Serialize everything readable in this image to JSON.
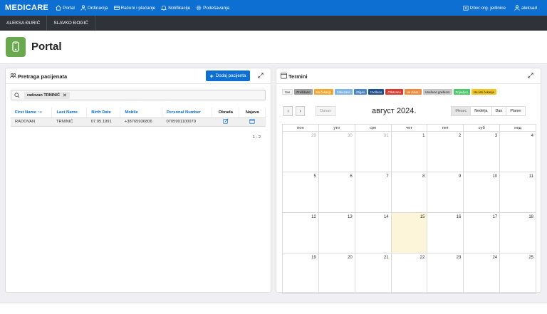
{
  "topbar": {
    "brand": "MEDICARE",
    "nav": [
      "Portal",
      "Ordinacija",
      "Računi i plaćanje",
      "Notifikacije",
      "Podešavanja"
    ],
    "org_unit": "Izbor org. jedinice",
    "user": "aleksad"
  },
  "user_tabs": [
    "ALEKSA ĐURIĆ",
    "SLAVKO ĐOGIĆ"
  ],
  "page_title": "Portal",
  "patients": {
    "title": "Pretraga pacijenata",
    "add_button": "Dodaj pacijenta",
    "search_chip": "radovan TRNINIĆ",
    "columns": [
      "First Name",
      "Last Name",
      "Birth Date",
      "Mobile",
      "Personal Number",
      "Obrada",
      "Najava"
    ],
    "rows": [
      [
        "RADOVAN",
        "TRNINIĆ",
        "07.05.1991",
        "+38765936806",
        "0705991100079"
      ]
    ],
    "pager": "1 - 2"
  },
  "calendar": {
    "title": "Termini",
    "legend": [
      {
        "label": "Sve",
        "color": "#f2f2f2",
        "text": "#222"
      },
      {
        "label": "Prešišano",
        "color": "#9e9e9e",
        "text": "#222"
      },
      {
        "label": "Na čekanju",
        "color": "#f0a830",
        "text": "#fff"
      },
      {
        "label": "Zakazano",
        "color": "#7fb6e6",
        "text": "#fff"
      },
      {
        "label": "Stigao",
        "color": "#4a86c5",
        "text": "#fff"
      },
      {
        "label": "Izvršeno",
        "color": "#1f4e8c",
        "text": "#fff"
      },
      {
        "label": "Otkazano",
        "color": "#d93a2e",
        "text": "#fff"
      },
      {
        "label": "Ne dolazi",
        "color": "#ef8a3c",
        "text": "#fff"
      },
      {
        "label": "Unešeno greškom",
        "color": "#c8c8c8",
        "text": "#222"
      },
      {
        "label": "Prijavljen",
        "color": "#4cc96a",
        "text": "#fff"
      },
      {
        "label": "Na listi čekanja",
        "color": "#f2c523",
        "text": "#222"
      }
    ],
    "today_label": "Danas",
    "month_title": "август 2024.",
    "views": [
      "Mesec",
      "Nedelja",
      "Dan",
      "Planer"
    ],
    "weekdays": [
      "пон",
      "уто",
      "сре",
      "чет",
      "пет",
      "суб",
      "нед"
    ],
    "weeks": [
      [
        {
          "d": "29",
          "o": true
        },
        {
          "d": "30",
          "o": true
        },
        {
          "d": "31",
          "o": true
        },
        {
          "d": "1"
        },
        {
          "d": "2"
        },
        {
          "d": "3"
        },
        {
          "d": "4"
        }
      ],
      [
        {
          "d": "5"
        },
        {
          "d": "6"
        },
        {
          "d": "7"
        },
        {
          "d": "8"
        },
        {
          "d": "9"
        },
        {
          "d": "10"
        },
        {
          "d": "11"
        }
      ],
      [
        {
          "d": "12"
        },
        {
          "d": "13"
        },
        {
          "d": "14"
        },
        {
          "d": "15",
          "t": true
        },
        {
          "d": "16"
        },
        {
          "d": "17"
        },
        {
          "d": "18"
        }
      ],
      [
        {
          "d": "19"
        },
        {
          "d": "20"
        },
        {
          "d": "21"
        },
        {
          "d": "22"
        },
        {
          "d": "23"
        },
        {
          "d": "24"
        },
        {
          "d": "25"
        }
      ]
    ]
  }
}
